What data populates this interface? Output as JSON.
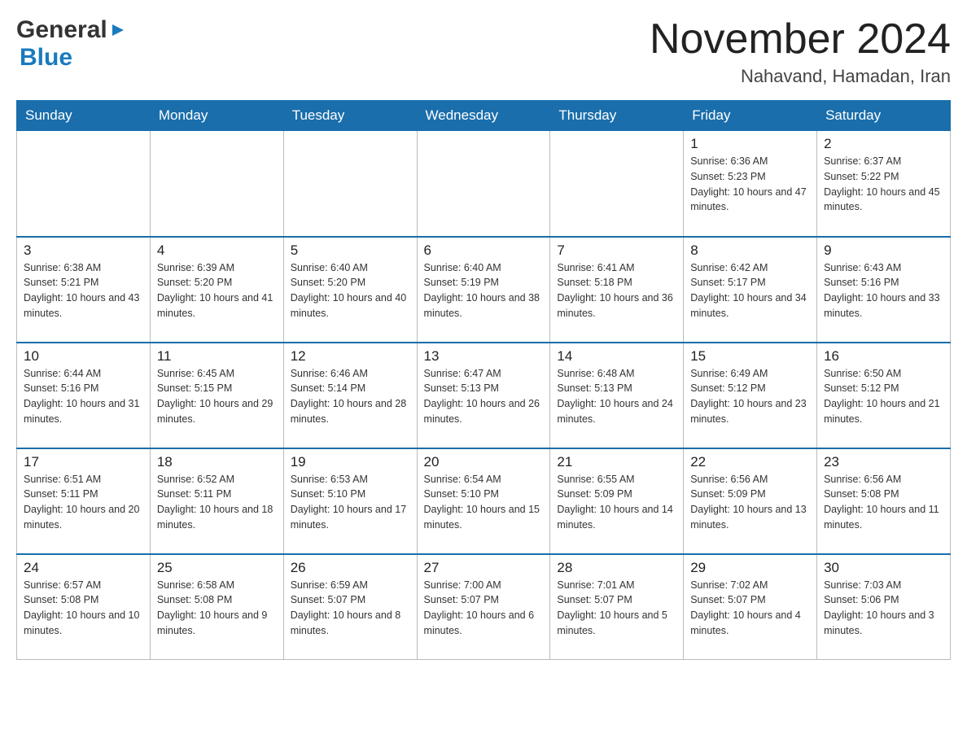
{
  "header": {
    "logo_general": "General",
    "logo_blue": "Blue",
    "month_title": "November 2024",
    "location": "Nahavand, Hamadan, Iran"
  },
  "days_of_week": [
    "Sunday",
    "Monday",
    "Tuesday",
    "Wednesday",
    "Thursday",
    "Friday",
    "Saturday"
  ],
  "weeks": [
    [
      {
        "day": "",
        "info": ""
      },
      {
        "day": "",
        "info": ""
      },
      {
        "day": "",
        "info": ""
      },
      {
        "day": "",
        "info": ""
      },
      {
        "day": "",
        "info": ""
      },
      {
        "day": "1",
        "info": "Sunrise: 6:36 AM\nSunset: 5:23 PM\nDaylight: 10 hours and 47 minutes."
      },
      {
        "day": "2",
        "info": "Sunrise: 6:37 AM\nSunset: 5:22 PM\nDaylight: 10 hours and 45 minutes."
      }
    ],
    [
      {
        "day": "3",
        "info": "Sunrise: 6:38 AM\nSunset: 5:21 PM\nDaylight: 10 hours and 43 minutes."
      },
      {
        "day": "4",
        "info": "Sunrise: 6:39 AM\nSunset: 5:20 PM\nDaylight: 10 hours and 41 minutes."
      },
      {
        "day": "5",
        "info": "Sunrise: 6:40 AM\nSunset: 5:20 PM\nDaylight: 10 hours and 40 minutes."
      },
      {
        "day": "6",
        "info": "Sunrise: 6:40 AM\nSunset: 5:19 PM\nDaylight: 10 hours and 38 minutes."
      },
      {
        "day": "7",
        "info": "Sunrise: 6:41 AM\nSunset: 5:18 PM\nDaylight: 10 hours and 36 minutes."
      },
      {
        "day": "8",
        "info": "Sunrise: 6:42 AM\nSunset: 5:17 PM\nDaylight: 10 hours and 34 minutes."
      },
      {
        "day": "9",
        "info": "Sunrise: 6:43 AM\nSunset: 5:16 PM\nDaylight: 10 hours and 33 minutes."
      }
    ],
    [
      {
        "day": "10",
        "info": "Sunrise: 6:44 AM\nSunset: 5:16 PM\nDaylight: 10 hours and 31 minutes."
      },
      {
        "day": "11",
        "info": "Sunrise: 6:45 AM\nSunset: 5:15 PM\nDaylight: 10 hours and 29 minutes."
      },
      {
        "day": "12",
        "info": "Sunrise: 6:46 AM\nSunset: 5:14 PM\nDaylight: 10 hours and 28 minutes."
      },
      {
        "day": "13",
        "info": "Sunrise: 6:47 AM\nSunset: 5:13 PM\nDaylight: 10 hours and 26 minutes."
      },
      {
        "day": "14",
        "info": "Sunrise: 6:48 AM\nSunset: 5:13 PM\nDaylight: 10 hours and 24 minutes."
      },
      {
        "day": "15",
        "info": "Sunrise: 6:49 AM\nSunset: 5:12 PM\nDaylight: 10 hours and 23 minutes."
      },
      {
        "day": "16",
        "info": "Sunrise: 6:50 AM\nSunset: 5:12 PM\nDaylight: 10 hours and 21 minutes."
      }
    ],
    [
      {
        "day": "17",
        "info": "Sunrise: 6:51 AM\nSunset: 5:11 PM\nDaylight: 10 hours and 20 minutes."
      },
      {
        "day": "18",
        "info": "Sunrise: 6:52 AM\nSunset: 5:11 PM\nDaylight: 10 hours and 18 minutes."
      },
      {
        "day": "19",
        "info": "Sunrise: 6:53 AM\nSunset: 5:10 PM\nDaylight: 10 hours and 17 minutes."
      },
      {
        "day": "20",
        "info": "Sunrise: 6:54 AM\nSunset: 5:10 PM\nDaylight: 10 hours and 15 minutes."
      },
      {
        "day": "21",
        "info": "Sunrise: 6:55 AM\nSunset: 5:09 PM\nDaylight: 10 hours and 14 minutes."
      },
      {
        "day": "22",
        "info": "Sunrise: 6:56 AM\nSunset: 5:09 PM\nDaylight: 10 hours and 13 minutes."
      },
      {
        "day": "23",
        "info": "Sunrise: 6:56 AM\nSunset: 5:08 PM\nDaylight: 10 hours and 11 minutes."
      }
    ],
    [
      {
        "day": "24",
        "info": "Sunrise: 6:57 AM\nSunset: 5:08 PM\nDaylight: 10 hours and 10 minutes."
      },
      {
        "day": "25",
        "info": "Sunrise: 6:58 AM\nSunset: 5:08 PM\nDaylight: 10 hours and 9 minutes."
      },
      {
        "day": "26",
        "info": "Sunrise: 6:59 AM\nSunset: 5:07 PM\nDaylight: 10 hours and 8 minutes."
      },
      {
        "day": "27",
        "info": "Sunrise: 7:00 AM\nSunset: 5:07 PM\nDaylight: 10 hours and 6 minutes."
      },
      {
        "day": "28",
        "info": "Sunrise: 7:01 AM\nSunset: 5:07 PM\nDaylight: 10 hours and 5 minutes."
      },
      {
        "day": "29",
        "info": "Sunrise: 7:02 AM\nSunset: 5:07 PM\nDaylight: 10 hours and 4 minutes."
      },
      {
        "day": "30",
        "info": "Sunrise: 7:03 AM\nSunset: 5:06 PM\nDaylight: 10 hours and 3 minutes."
      }
    ]
  ]
}
